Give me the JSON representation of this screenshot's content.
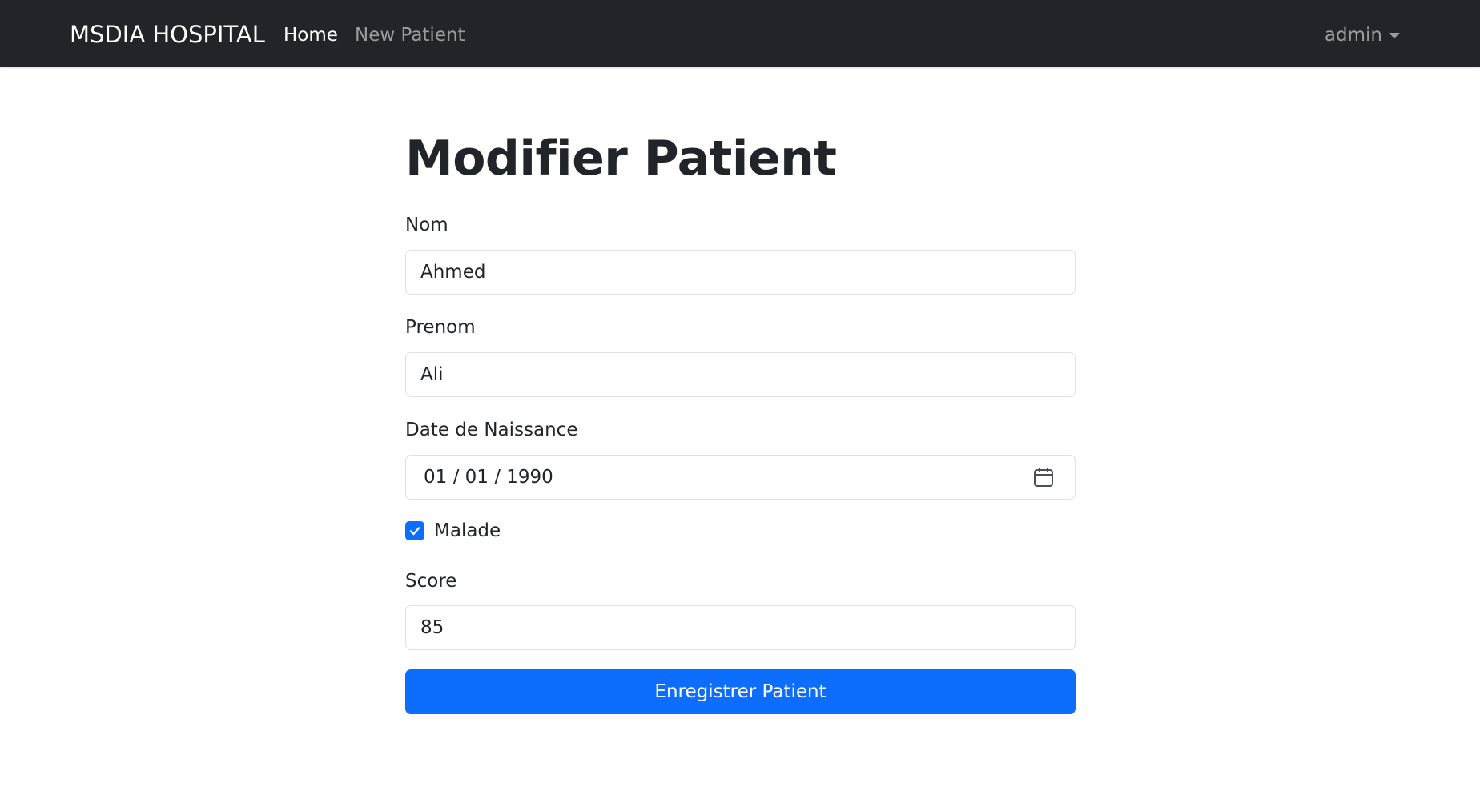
{
  "navbar": {
    "brand": "MSDIA HOSPITAL",
    "links": [
      {
        "label": "Home",
        "active": true
      },
      {
        "label": "New Patient",
        "active": false
      }
    ],
    "user": "admin"
  },
  "page": {
    "title": "Modifier Patient"
  },
  "form": {
    "nom": {
      "label": "Nom",
      "value": "Ahmed"
    },
    "prenom": {
      "label": "Prenom",
      "value": "Ali"
    },
    "date_naissance": {
      "label": "Date de Naissance",
      "value": "01 / 01 / 1990"
    },
    "malade": {
      "label": "Malade",
      "checked": true
    },
    "score": {
      "label": "Score",
      "value": "85"
    },
    "submit_label": "Enregistrer Patient"
  },
  "colors": {
    "navbar_bg": "#212529",
    "primary": "#0d6efd",
    "text": "#212529",
    "border": "#dee2e6"
  },
  "icons": {
    "date_picker": "calendar-icon",
    "checkbox": "check-icon",
    "user_menu": "caret-down-icon"
  }
}
